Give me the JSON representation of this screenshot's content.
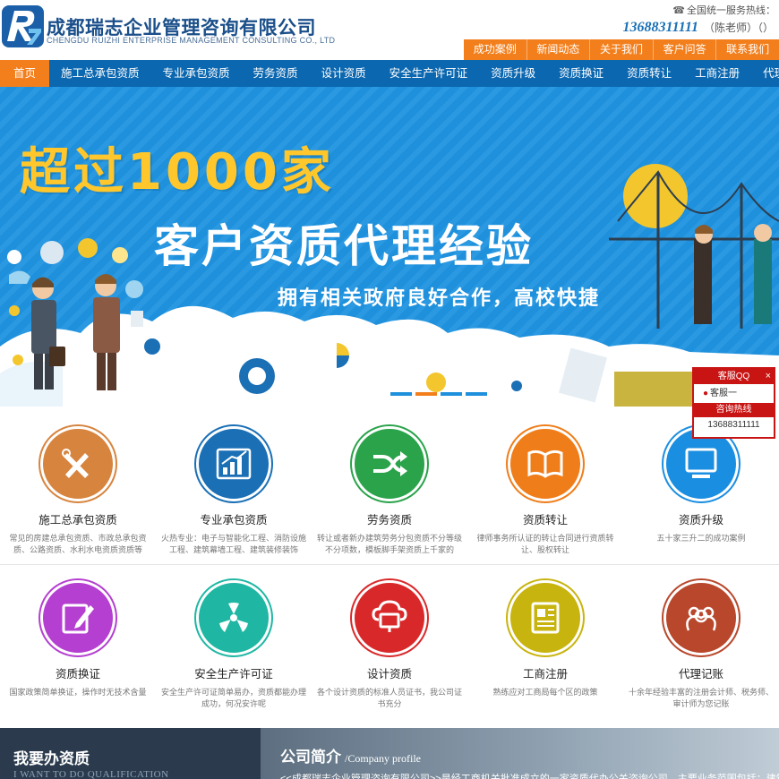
{
  "header": {
    "company_cn": "成都瑞志企业管理咨询有限公司",
    "company_en": "CHENGDU RUIZHI ENTERPRISE MANAGEMENT CONSULTING CO., LTD",
    "hotline_label": "全国统一服务热线：",
    "hotline_number": "13688311111",
    "hotline_contact": "（陈老师）（）",
    "subnav": [
      "成功案例",
      "新闻动态",
      "关于我们",
      "客户问答",
      "联系我们"
    ]
  },
  "nav": {
    "items": [
      "首页",
      "施工总承包资质",
      "专业承包资质",
      "劳务资质",
      "设计资质",
      "安全生产许可证",
      "资质升级",
      "资质换证",
      "资质转让",
      "工商注册",
      "代理记账"
    ],
    "active_index": 0
  },
  "banner": {
    "headline": "超过1000家",
    "subheadline": "客户资质代理经验",
    "tagline": "拥有相关政府良好合作，高校快捷",
    "active_slide": 1,
    "slide_count": 4
  },
  "services_row1": [
    {
      "title": "施工总承包资质",
      "desc": "常见的房建总承包资质、市政总承包资质、公路资质、水利水电资质资质等",
      "color": "#d7843e",
      "icon": "tools-icon"
    },
    {
      "title": "专业承包资质",
      "desc": "火热专业：电子与智能化工程、消防设施工程、建筑幕墙工程、建筑装修装饰",
      "color": "#1a6fb5",
      "icon": "bar-chart-icon"
    },
    {
      "title": "劳务资质",
      "desc": "转让或者新办建筑劳务分包资质不分等级不分项数，模板脚手架资质上千家的",
      "color": "#2aa34a",
      "icon": "shuffle-icon"
    },
    {
      "title": "资质转让",
      "desc": "律师事务所认证的转让合同进行资质转让、股权转让",
      "color": "#ef7d1a",
      "icon": "book-icon"
    },
    {
      "title": "资质升级",
      "desc": "五十家三升二的成功案例",
      "color": "#1a8ee0",
      "icon": "monitor-icon"
    }
  ],
  "services_row2": [
    {
      "title": "资质换证",
      "desc": "国家政策简单换证，操作时无技术含量",
      "color": "#b43fd0",
      "icon": "edit-icon"
    },
    {
      "title": "安全生产许可证",
      "desc": "安全生产许可证简单易办，资质都能办理成功，何况安许呢",
      "color": "#1fb7a3",
      "icon": "radiation-icon"
    },
    {
      "title": "设计资质",
      "desc": "各个设计资质的标准人员证书，我公司证书充分",
      "color": "#d9282a",
      "icon": "cloud-computer-icon"
    },
    {
      "title": "工商注册",
      "desc": "熟练应对工商局每个区的政策",
      "color": "#c8b40f",
      "icon": "newspaper-icon"
    },
    {
      "title": "代理记账",
      "desc": "十余年经验丰富的注册会计师、税务师、审计师为您记账",
      "color": "#b8472c",
      "icon": "group-icon"
    }
  ],
  "qq_float": {
    "title": "客服QQ",
    "close": "×",
    "agent": "客服一",
    "hotline_title": "咨询热线",
    "hotline_number": "13688311111"
  },
  "bottom": {
    "left_title": "我要办资质",
    "left_subtitle": "I WANT TO DO QUALIFICATION",
    "right_title": "公司简介",
    "right_subtitle": "/Company profile",
    "right_text": "<<成都瑞志企业管理咨询有限公司>>是经工商机关批准成立的一家资质代办公关咨询公司，主要业务范围包括：建筑资质代"
  }
}
